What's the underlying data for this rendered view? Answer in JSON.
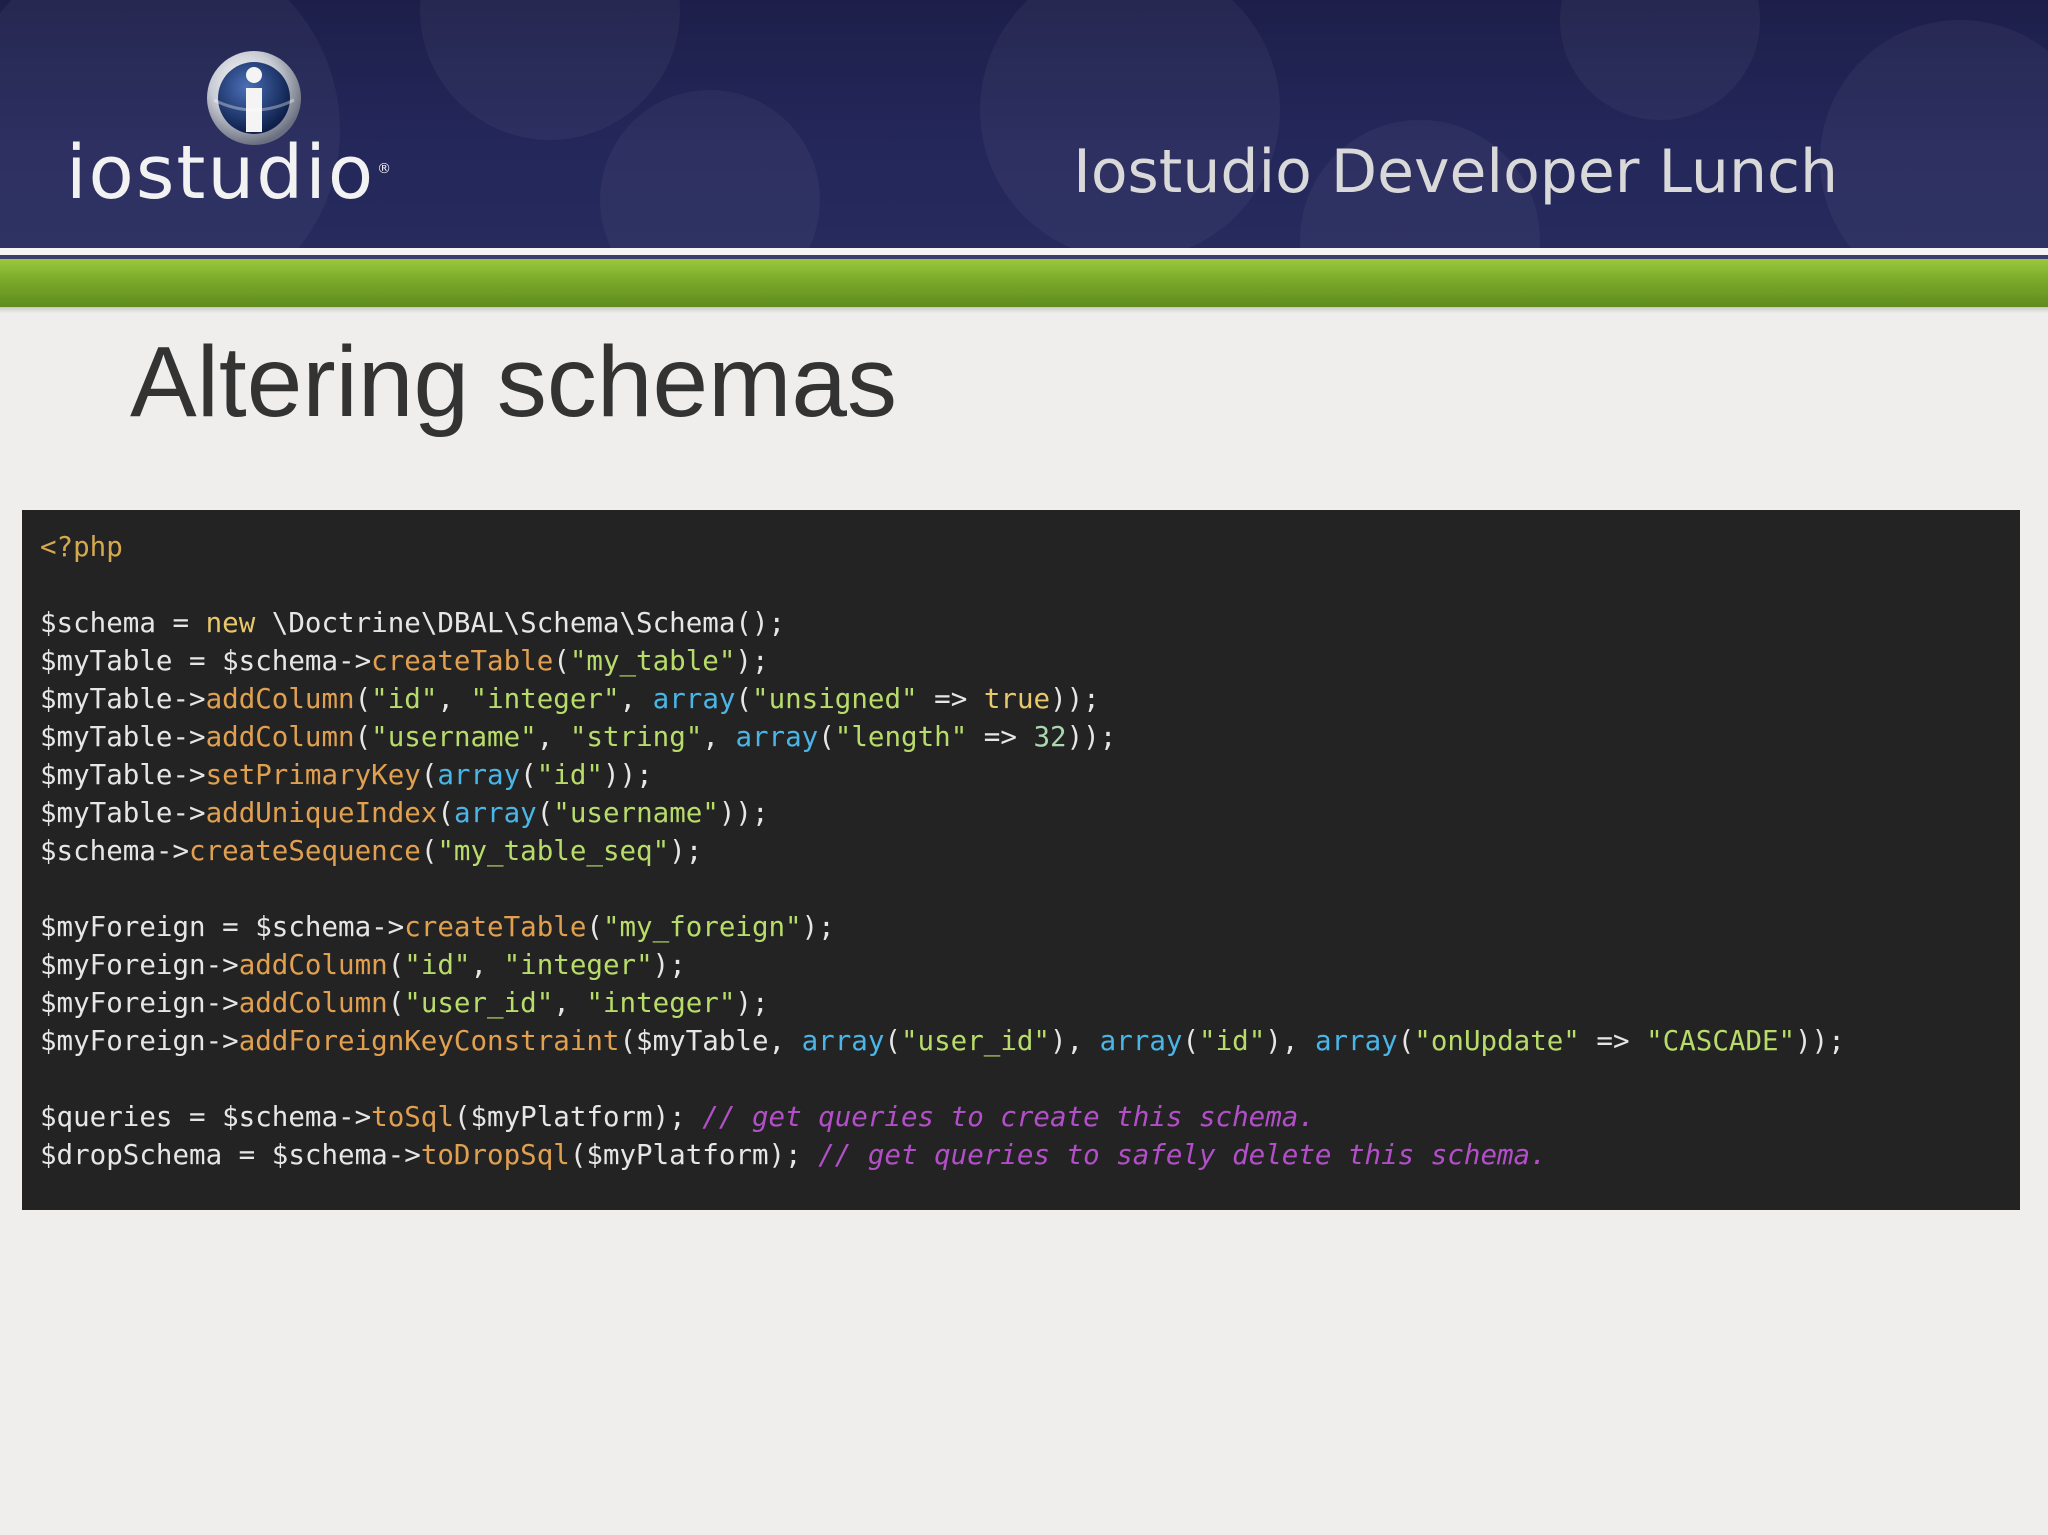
{
  "header": {
    "logo_text": "iostudio",
    "logo_registered": "®",
    "event_title": "Iostudio Developer Lunch",
    "background_color": "#24275a",
    "accent_color": "#7aa92a"
  },
  "slide": {
    "title": "Altering schemas"
  },
  "code": {
    "language": "php",
    "background_color": "#232323",
    "lines": [
      [
        {
          "t": "tag",
          "v": "<?php"
        }
      ],
      [],
      [
        {
          "t": "plain",
          "v": "$schema = "
        },
        {
          "t": "keyword",
          "v": "new"
        },
        {
          "t": "plain",
          "v": " \\Doctrine\\DBAL\\Schema\\Schema();"
        }
      ],
      [
        {
          "t": "plain",
          "v": "$myTable = $schema->"
        },
        {
          "t": "method",
          "v": "createTable"
        },
        {
          "t": "plain",
          "v": "("
        },
        {
          "t": "string",
          "v": "\"my_table\""
        },
        {
          "t": "plain",
          "v": ");"
        }
      ],
      [
        {
          "t": "plain",
          "v": "$myTable->"
        },
        {
          "t": "method",
          "v": "addColumn"
        },
        {
          "t": "plain",
          "v": "("
        },
        {
          "t": "string",
          "v": "\"id\""
        },
        {
          "t": "plain",
          "v": ", "
        },
        {
          "t": "string",
          "v": "\"integer\""
        },
        {
          "t": "plain",
          "v": ", "
        },
        {
          "t": "builtin",
          "v": "array"
        },
        {
          "t": "plain",
          "v": "("
        },
        {
          "t": "string",
          "v": "\"unsigned\""
        },
        {
          "t": "plain",
          "v": " => "
        },
        {
          "t": "keyword",
          "v": "true"
        },
        {
          "t": "plain",
          "v": "));"
        }
      ],
      [
        {
          "t": "plain",
          "v": "$myTable->"
        },
        {
          "t": "method",
          "v": "addColumn"
        },
        {
          "t": "plain",
          "v": "("
        },
        {
          "t": "string",
          "v": "\"username\""
        },
        {
          "t": "plain",
          "v": ", "
        },
        {
          "t": "string",
          "v": "\"string\""
        },
        {
          "t": "plain",
          "v": ", "
        },
        {
          "t": "builtin",
          "v": "array"
        },
        {
          "t": "plain",
          "v": "("
        },
        {
          "t": "string",
          "v": "\"length\""
        },
        {
          "t": "plain",
          "v": " => "
        },
        {
          "t": "number",
          "v": "32"
        },
        {
          "t": "plain",
          "v": "));"
        }
      ],
      [
        {
          "t": "plain",
          "v": "$myTable->"
        },
        {
          "t": "method",
          "v": "setPrimaryKey"
        },
        {
          "t": "plain",
          "v": "("
        },
        {
          "t": "builtin",
          "v": "array"
        },
        {
          "t": "plain",
          "v": "("
        },
        {
          "t": "string",
          "v": "\"id\""
        },
        {
          "t": "plain",
          "v": "));"
        }
      ],
      [
        {
          "t": "plain",
          "v": "$myTable->"
        },
        {
          "t": "method",
          "v": "addUniqueIndex"
        },
        {
          "t": "plain",
          "v": "("
        },
        {
          "t": "builtin",
          "v": "array"
        },
        {
          "t": "plain",
          "v": "("
        },
        {
          "t": "string",
          "v": "\"username\""
        },
        {
          "t": "plain",
          "v": "));"
        }
      ],
      [
        {
          "t": "plain",
          "v": "$schema->"
        },
        {
          "t": "method",
          "v": "createSequence"
        },
        {
          "t": "plain",
          "v": "("
        },
        {
          "t": "string",
          "v": "\"my_table_seq\""
        },
        {
          "t": "plain",
          "v": ");"
        }
      ],
      [],
      [
        {
          "t": "plain",
          "v": "$myForeign = $schema->"
        },
        {
          "t": "method",
          "v": "createTable"
        },
        {
          "t": "plain",
          "v": "("
        },
        {
          "t": "string",
          "v": "\"my_foreign\""
        },
        {
          "t": "plain",
          "v": ");"
        }
      ],
      [
        {
          "t": "plain",
          "v": "$myForeign->"
        },
        {
          "t": "method",
          "v": "addColumn"
        },
        {
          "t": "plain",
          "v": "("
        },
        {
          "t": "string",
          "v": "\"id\""
        },
        {
          "t": "plain",
          "v": ", "
        },
        {
          "t": "string",
          "v": "\"integer\""
        },
        {
          "t": "plain",
          "v": ");"
        }
      ],
      [
        {
          "t": "plain",
          "v": "$myForeign->"
        },
        {
          "t": "method",
          "v": "addColumn"
        },
        {
          "t": "plain",
          "v": "("
        },
        {
          "t": "string",
          "v": "\"user_id\""
        },
        {
          "t": "plain",
          "v": ", "
        },
        {
          "t": "string",
          "v": "\"integer\""
        },
        {
          "t": "plain",
          "v": ");"
        }
      ],
      [
        {
          "t": "plain",
          "v": "$myForeign->"
        },
        {
          "t": "method",
          "v": "addForeignKeyConstraint"
        },
        {
          "t": "plain",
          "v": "($myTable, "
        },
        {
          "t": "builtin",
          "v": "array"
        },
        {
          "t": "plain",
          "v": "("
        },
        {
          "t": "string",
          "v": "\"user_id\""
        },
        {
          "t": "plain",
          "v": "), "
        },
        {
          "t": "builtin",
          "v": "array"
        },
        {
          "t": "plain",
          "v": "("
        },
        {
          "t": "string",
          "v": "\"id\""
        },
        {
          "t": "plain",
          "v": "), "
        },
        {
          "t": "builtin",
          "v": "array"
        },
        {
          "t": "plain",
          "v": "("
        },
        {
          "t": "string",
          "v": "\"onUpdate\""
        },
        {
          "t": "plain",
          "v": " => "
        },
        {
          "t": "string",
          "v": "\"CASCADE\""
        },
        {
          "t": "plain",
          "v": "));"
        }
      ],
      [],
      [
        {
          "t": "plain",
          "v": "$queries = $schema->"
        },
        {
          "t": "method",
          "v": "toSql"
        },
        {
          "t": "plain",
          "v": "($myPlatform); "
        },
        {
          "t": "comment",
          "v": "// get queries to create this schema."
        }
      ],
      [
        {
          "t": "plain",
          "v": "$dropSchema = $schema->"
        },
        {
          "t": "method",
          "v": "toDropSql"
        },
        {
          "t": "plain",
          "v": "($myPlatform); "
        },
        {
          "t": "comment",
          "v": "// get queries to safely delete this schema."
        }
      ]
    ]
  }
}
